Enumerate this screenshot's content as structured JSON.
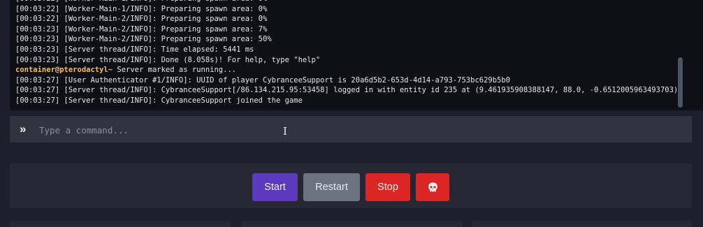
{
  "console": {
    "lines": [
      {
        "prefix": "",
        "text": "[00:03:22] [Worker-Main-1/INFO]: Preparing spawn area: 0%"
      },
      {
        "prefix": "",
        "text": "[00:03:22] [Worker-Main-1/INFO]: Preparing spawn area: 0%"
      },
      {
        "prefix": "",
        "text": "[00:03:22] [Worker-Main-2/INFO]: Preparing spawn area: 0%"
      },
      {
        "prefix": "",
        "text": "[00:03:23] [Worker-Main-2/INFO]: Preparing spawn area: 7%"
      },
      {
        "prefix": "",
        "text": "[00:03:23] [Worker-Main-2/INFO]: Preparing spawn area: 50%"
      },
      {
        "prefix": "",
        "text": "[00:03:23] [Server thread/INFO]: Time elapsed: 5441 ms"
      },
      {
        "prefix": "",
        "text": "[00:03:23] [Server thread/INFO]: Done (8.058s)! For help, type \"help\""
      },
      {
        "prefix": "container@pterodactyl~",
        "text": " Server marked as running..."
      },
      {
        "prefix": "",
        "text": "[00:03:27] [User Authenticator #1/INFO]: UUID of player CybranceeSupport is 20a6d5b2-653d-4d14-a793-753bc629b5b0"
      },
      {
        "prefix": "",
        "text": "[00:03:27] [Server thread/INFO]: CybranceeSupport[/86.134.215.95:53458] logged in with entity id 235 at (9.461935908388147, 88.0, -0.6512005963493703)"
      },
      {
        "prefix": "",
        "text": "[00:03:27] [Server thread/INFO]: CybranceeSupport joined the game"
      }
    ]
  },
  "command": {
    "prompt_icon": "»",
    "placeholder": "Type a command..."
  },
  "power": {
    "start_label": "Start",
    "restart_label": "Restart",
    "stop_label": "Stop",
    "kill_icon": "skull-icon"
  },
  "colors": {
    "start": "#5a3bc0",
    "restart": "#6b7280",
    "stop": "#dc2626",
    "prompt_prefix": "#f6c049"
  }
}
